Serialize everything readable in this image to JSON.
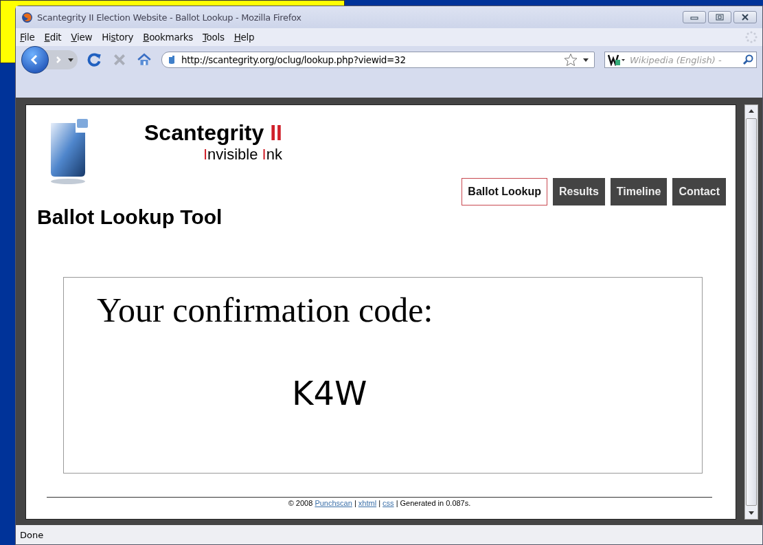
{
  "window": {
    "title": "Scantegrity II Election Website - Ballot Lookup - Mozilla Firefox"
  },
  "menu": [
    {
      "accel": "F",
      "after": "ile"
    },
    {
      "accel": "E",
      "after": "dit"
    },
    {
      "accel": "V",
      "after": "iew"
    },
    {
      "before": "Hi",
      "accel": "s",
      "after": "tory"
    },
    {
      "accel": "B",
      "after": "ookmarks"
    },
    {
      "accel": "T",
      "after": "ools"
    },
    {
      "accel": "H",
      "after": "elp"
    }
  ],
  "address": {
    "value": "http://scantegrity.org/oclug/lookup.php?viewid=32"
  },
  "search": {
    "placeholder": "Wikipedia (English) -"
  },
  "site": {
    "brand": [
      {
        "text": "Scantegrity ",
        "accent": false
      },
      {
        "text": "II",
        "accent": true
      }
    ],
    "tagline": [
      {
        "text": "I",
        "accent": true
      },
      {
        "text": "nvisible ",
        "accent": false
      },
      {
        "text": "I",
        "accent": true
      },
      {
        "text": "nk",
        "accent": false
      }
    ],
    "nav": [
      {
        "label": "Ballot Lookup",
        "selected": true
      },
      {
        "label": "Results",
        "selected": false
      },
      {
        "label": "Timeline",
        "selected": false
      },
      {
        "label": "Contact",
        "selected": false
      }
    ],
    "heading": "Ballot Lookup Tool",
    "confirmation_label": "Your confirmation code:",
    "confirmation_code": "K4W",
    "footer": [
      {
        "text": "© 2008 ",
        "kind": "text"
      },
      {
        "text": "Punchscan",
        "kind": "link"
      },
      {
        "text": " | ",
        "kind": "text"
      },
      {
        "text": "xhtml",
        "kind": "link"
      },
      {
        "text": " | ",
        "kind": "text"
      },
      {
        "text": "css",
        "kind": "link"
      },
      {
        "text": " | Generated in 0.087s.",
        "kind": "text"
      }
    ]
  },
  "status_bar": {
    "text": "Done"
  }
}
